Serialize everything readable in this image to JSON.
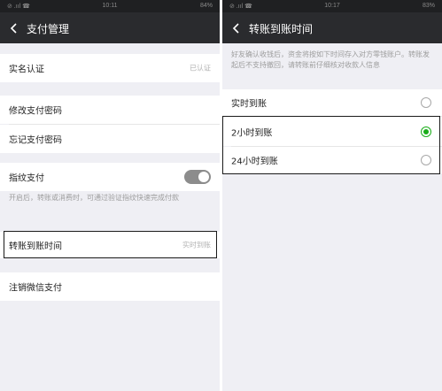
{
  "left_screen": {
    "status": {
      "left": "⊘ .ııl ☎",
      "time": "10:11",
      "battery": "84%"
    },
    "title": "支付管理",
    "rows": {
      "real_name": {
        "label": "实名认证",
        "value": "已认证"
      },
      "change_password": {
        "label": "修改支付密码"
      },
      "forgot_password": {
        "label": "忘记支付密码"
      },
      "fingerprint": {
        "label": "指纹支付",
        "toggle_on": false,
        "hint": "开启后，转账或消费时，可通过验证指纹快速完成付款"
      },
      "transfer_time": {
        "label": "转账到账时间",
        "value": "实时到账"
      },
      "cancel_pay": {
        "label": "注销微信支付"
      }
    }
  },
  "right_screen": {
    "status": {
      "left": "⊘ .ııl ☎",
      "time": "10:17",
      "battery": "83%"
    },
    "title": "转账到账时间",
    "description": "好友确认收钱后，资金将按如下时间存入对方零钱账户。转账发起后不支持撤回，请转账前仔细核对收款人信息",
    "options": [
      {
        "label": "实时到账",
        "selected": false
      },
      {
        "label": "2小时到账",
        "selected": true
      },
      {
        "label": "24小时到账",
        "selected": false
      }
    ]
  },
  "colors": {
    "navbar": "#2a2b2e",
    "accent": "#1aad19",
    "background": "#efeff4"
  }
}
